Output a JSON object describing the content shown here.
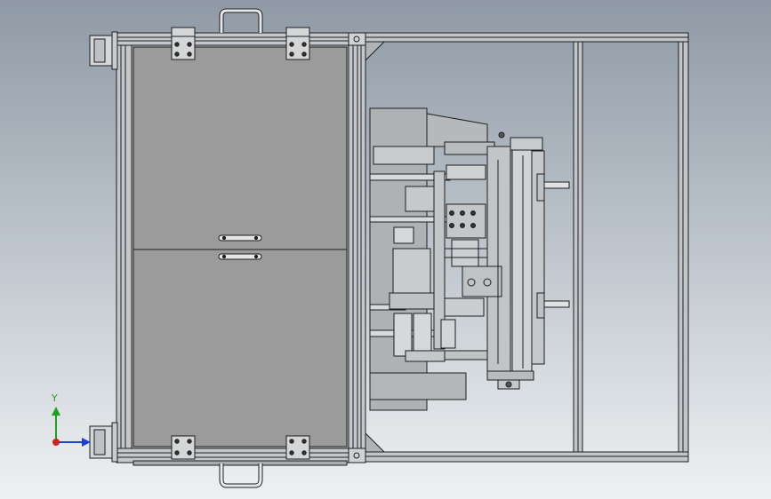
{
  "colors": {
    "background_top": "#8f9aa6",
    "background_bottom": "#e8ecef",
    "frame_steel": "#b4b8bc",
    "panel_gray": "#9c9c9c",
    "line_dark": "#1e1e1e",
    "axis_y": "#1fa01f",
    "axis_x": "#d21f1f",
    "axis_z": "#1f3fd2"
  },
  "triad": {
    "y_label": "Y"
  },
  "icons": {
    "handle": "u-handle-icon",
    "hinge": "hinge-icon",
    "triad": "coordinate-triad-icon"
  }
}
